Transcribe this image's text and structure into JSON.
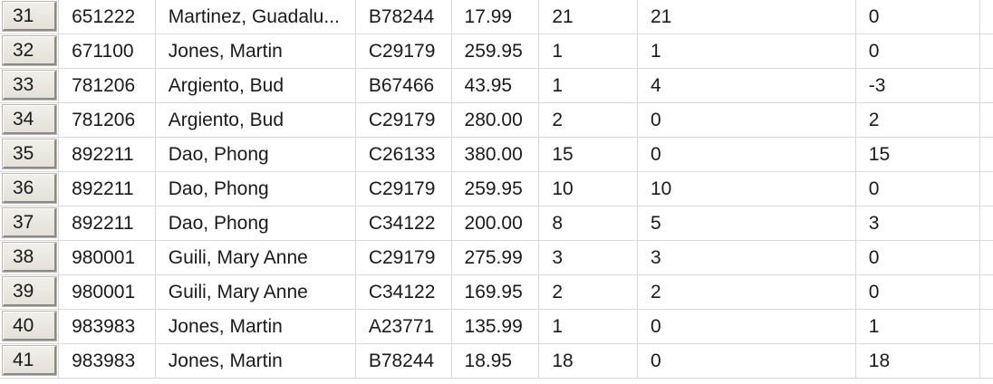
{
  "grid": {
    "rows": [
      {
        "num": "31",
        "id": "651222",
        "name": "Martinez, Guadalu...",
        "code": "B78244",
        "price": "17.99",
        "qty": "21",
        "col6": "21",
        "col7": "0"
      },
      {
        "num": "32",
        "id": "671100",
        "name": "Jones, Martin",
        "code": "C29179",
        "price": "259.95",
        "qty": "1",
        "col6": "1",
        "col7": "0"
      },
      {
        "num": "33",
        "id": "781206",
        "name": "Argiento, Bud",
        "code": "B67466",
        "price": "43.95",
        "qty": "1",
        "col6": "4",
        "col7": "-3"
      },
      {
        "num": "34",
        "id": "781206",
        "name": "Argiento, Bud",
        "code": "C29179",
        "price": "280.00",
        "qty": "2",
        "col6": "0",
        "col7": "2"
      },
      {
        "num": "35",
        "id": "892211",
        "name": "Dao, Phong",
        "code": "C26133",
        "price": "380.00",
        "qty": "15",
        "col6": "0",
        "col7": "15"
      },
      {
        "num": "36",
        "id": "892211",
        "name": "Dao, Phong",
        "code": "C29179",
        "price": "259.95",
        "qty": "10",
        "col6": "10",
        "col7": "0"
      },
      {
        "num": "37",
        "id": "892211",
        "name": "Dao, Phong",
        "code": "C34122",
        "price": "200.00",
        "qty": "8",
        "col6": "5",
        "col7": "3"
      },
      {
        "num": "38",
        "id": "980001",
        "name": "Guili, Mary Anne",
        "code": "C29179",
        "price": "275.99",
        "qty": "3",
        "col6": "3",
        "col7": "0"
      },
      {
        "num": "39",
        "id": "980001",
        "name": "Guili, Mary Anne",
        "code": "C34122",
        "price": "169.95",
        "qty": "2",
        "col6": "2",
        "col7": "0"
      },
      {
        "num": "40",
        "id": "983983",
        "name": "Jones, Martin",
        "code": "A23771",
        "price": "135.99",
        "qty": "1",
        "col6": "0",
        "col7": "1"
      },
      {
        "num": "41",
        "id": "983983",
        "name": "Jones, Martin",
        "code": "B78244",
        "price": "18.95",
        "qty": "18",
        "col6": "0",
        "col7": "18"
      }
    ]
  }
}
